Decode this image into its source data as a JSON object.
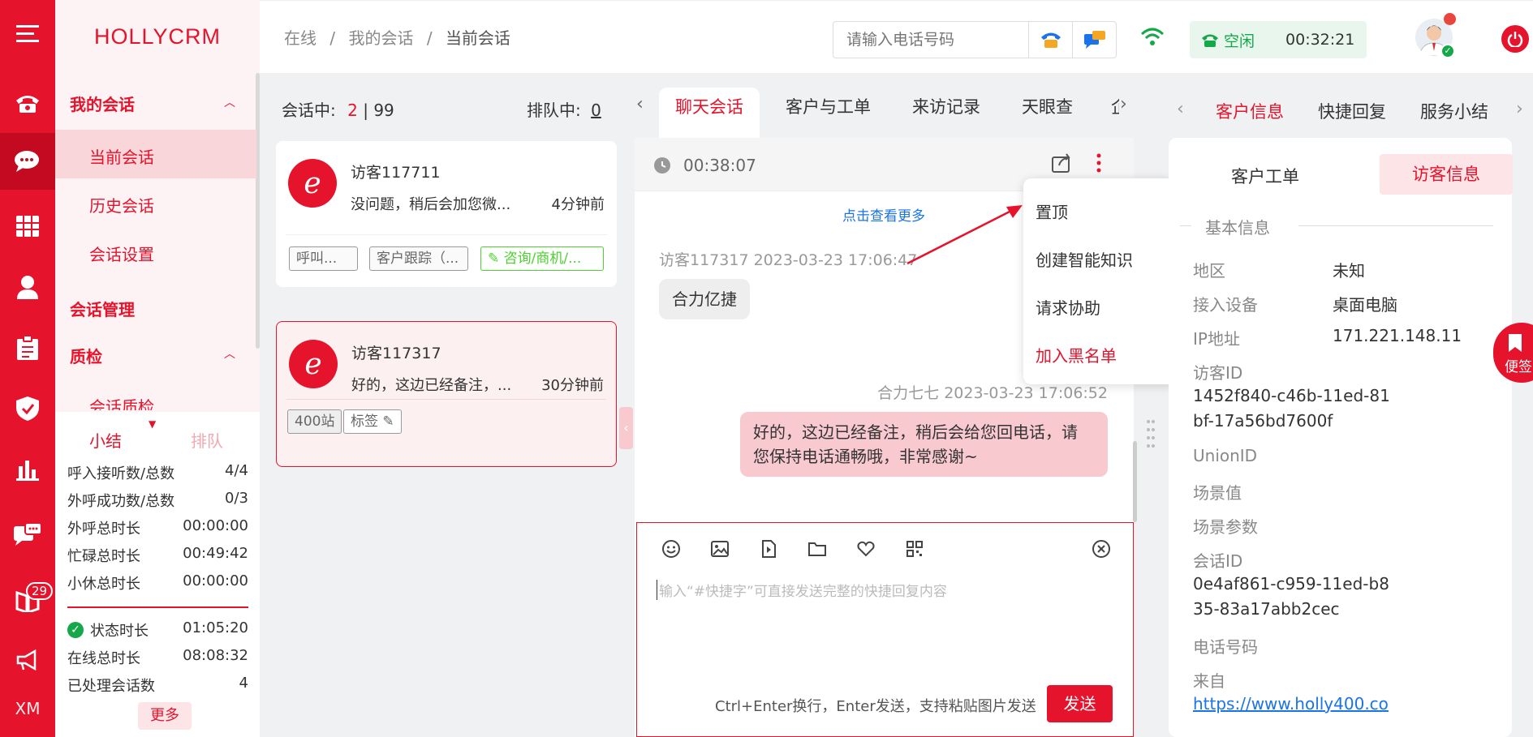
{
  "app": {
    "logo": "HOLLYCRM"
  },
  "rail": {
    "badge": "29",
    "footer": "XM"
  },
  "nav": {
    "my_sessions": "我的会话",
    "current_session": "当前会话",
    "history_session": "历史会话",
    "session_settings": "会话设置",
    "session_management": "会话管理",
    "quality": "质检",
    "quality_sub": "会话质检"
  },
  "stats": {
    "tab_summary": "小结",
    "tab_queue": "排队",
    "rows": [
      {
        "label": "呼入接听数/总数",
        "value": "4/4"
      },
      {
        "label": "外呼成功数/总数",
        "value": "0/3"
      },
      {
        "label": "外呼总时长",
        "value": "00:00:00"
      },
      {
        "label": "忙碌总时长",
        "value": "00:49:42"
      },
      {
        "label": "小休总时长",
        "value": "00:00:00"
      }
    ],
    "rows2": [
      {
        "label": "状态时长",
        "value": "01:05:20"
      },
      {
        "label": "在线总时长",
        "value": "08:08:32"
      },
      {
        "label": "已处理会话数",
        "value": "4"
      }
    ],
    "more": "更多"
  },
  "header": {
    "breadcrumb": [
      "在线",
      "我的会话",
      "当前会话"
    ],
    "sep": "/",
    "phone_placeholder": "请输入电话号码",
    "status_label": "空闲",
    "status_timer": "00:32:21"
  },
  "sessions": {
    "active_label": "会话中:",
    "active_count": "2",
    "active_sep": "|",
    "active_total": "99",
    "queue_label": "排队中:",
    "queue_count": "0",
    "items": [
      {
        "name": "访客117711",
        "message": "没问题，稍后会加您微...",
        "time": "4分钟前",
        "tags": [
          "呼叫...",
          "客户跟踪（...",
          "咨询/商机/..."
        ]
      },
      {
        "name": "访客117317",
        "message": "好的，这边已经备注，...",
        "time": "30分钟前",
        "tags": [
          "400站",
          "标签"
        ]
      }
    ]
  },
  "chat_tabs": [
    "聊天会话",
    "客户与工单",
    "来访记录",
    "天眼查",
    "企"
  ],
  "chat": {
    "timer": "00:38:07",
    "see_more": "点击查看更多",
    "msg1_meta": "访客117317 2023-03-23 17:06:47",
    "msg1_text": "合力亿捷",
    "msg2_meta": "合力七七 2023-03-23 17:06:52",
    "msg2_text_line1": "好的，这边已经备注，稍后会给您回电话，请",
    "msg2_text_line2": "您保持电话通畅哦，非常感谢~",
    "input_placeholder": "输入“#快捷字”可直接发送完整的快捷回复内容",
    "hint": "Ctrl+Enter换行，Enter发送，支持粘贴图片发送",
    "send": "发送"
  },
  "menu": {
    "pin": "置顶",
    "create_knowledge": "创建智能知识",
    "request_help": "请求协助",
    "blacklist": "加入黑名单"
  },
  "right_tabs": [
    "客户信息",
    "快捷回复",
    "服务小结"
  ],
  "right": {
    "sub_tab_ticket": "客户工单",
    "sub_tab_visitor": "访客信息",
    "section": "基本信息",
    "region_label": "地区",
    "region": "未知",
    "device_label": "接入设备",
    "device": "桌面电脑",
    "ip_label": "IP地址",
    "ip": "171.221.148.11",
    "visitor_id_label": "访客ID",
    "visitor_id_1": "1452f840-c46b-11ed-81",
    "visitor_id_2": "bf-17a56bd7600f",
    "unionid_label": "UnionID",
    "scene_label": "场景值",
    "scene_param_label": "场景参数",
    "session_id_label": "会话ID",
    "session_id_1": "0e4af861-c959-11ed-b8",
    "session_id_2": "35-83a17abb2cec",
    "phone_label": "电话号码",
    "from_label": "来自",
    "from": "https://www.holly400.co"
  },
  "note": {
    "label": "便签"
  },
  "colors": {
    "brand": "#e5132b",
    "online": "#15a84a",
    "link": "#1a73e8"
  }
}
